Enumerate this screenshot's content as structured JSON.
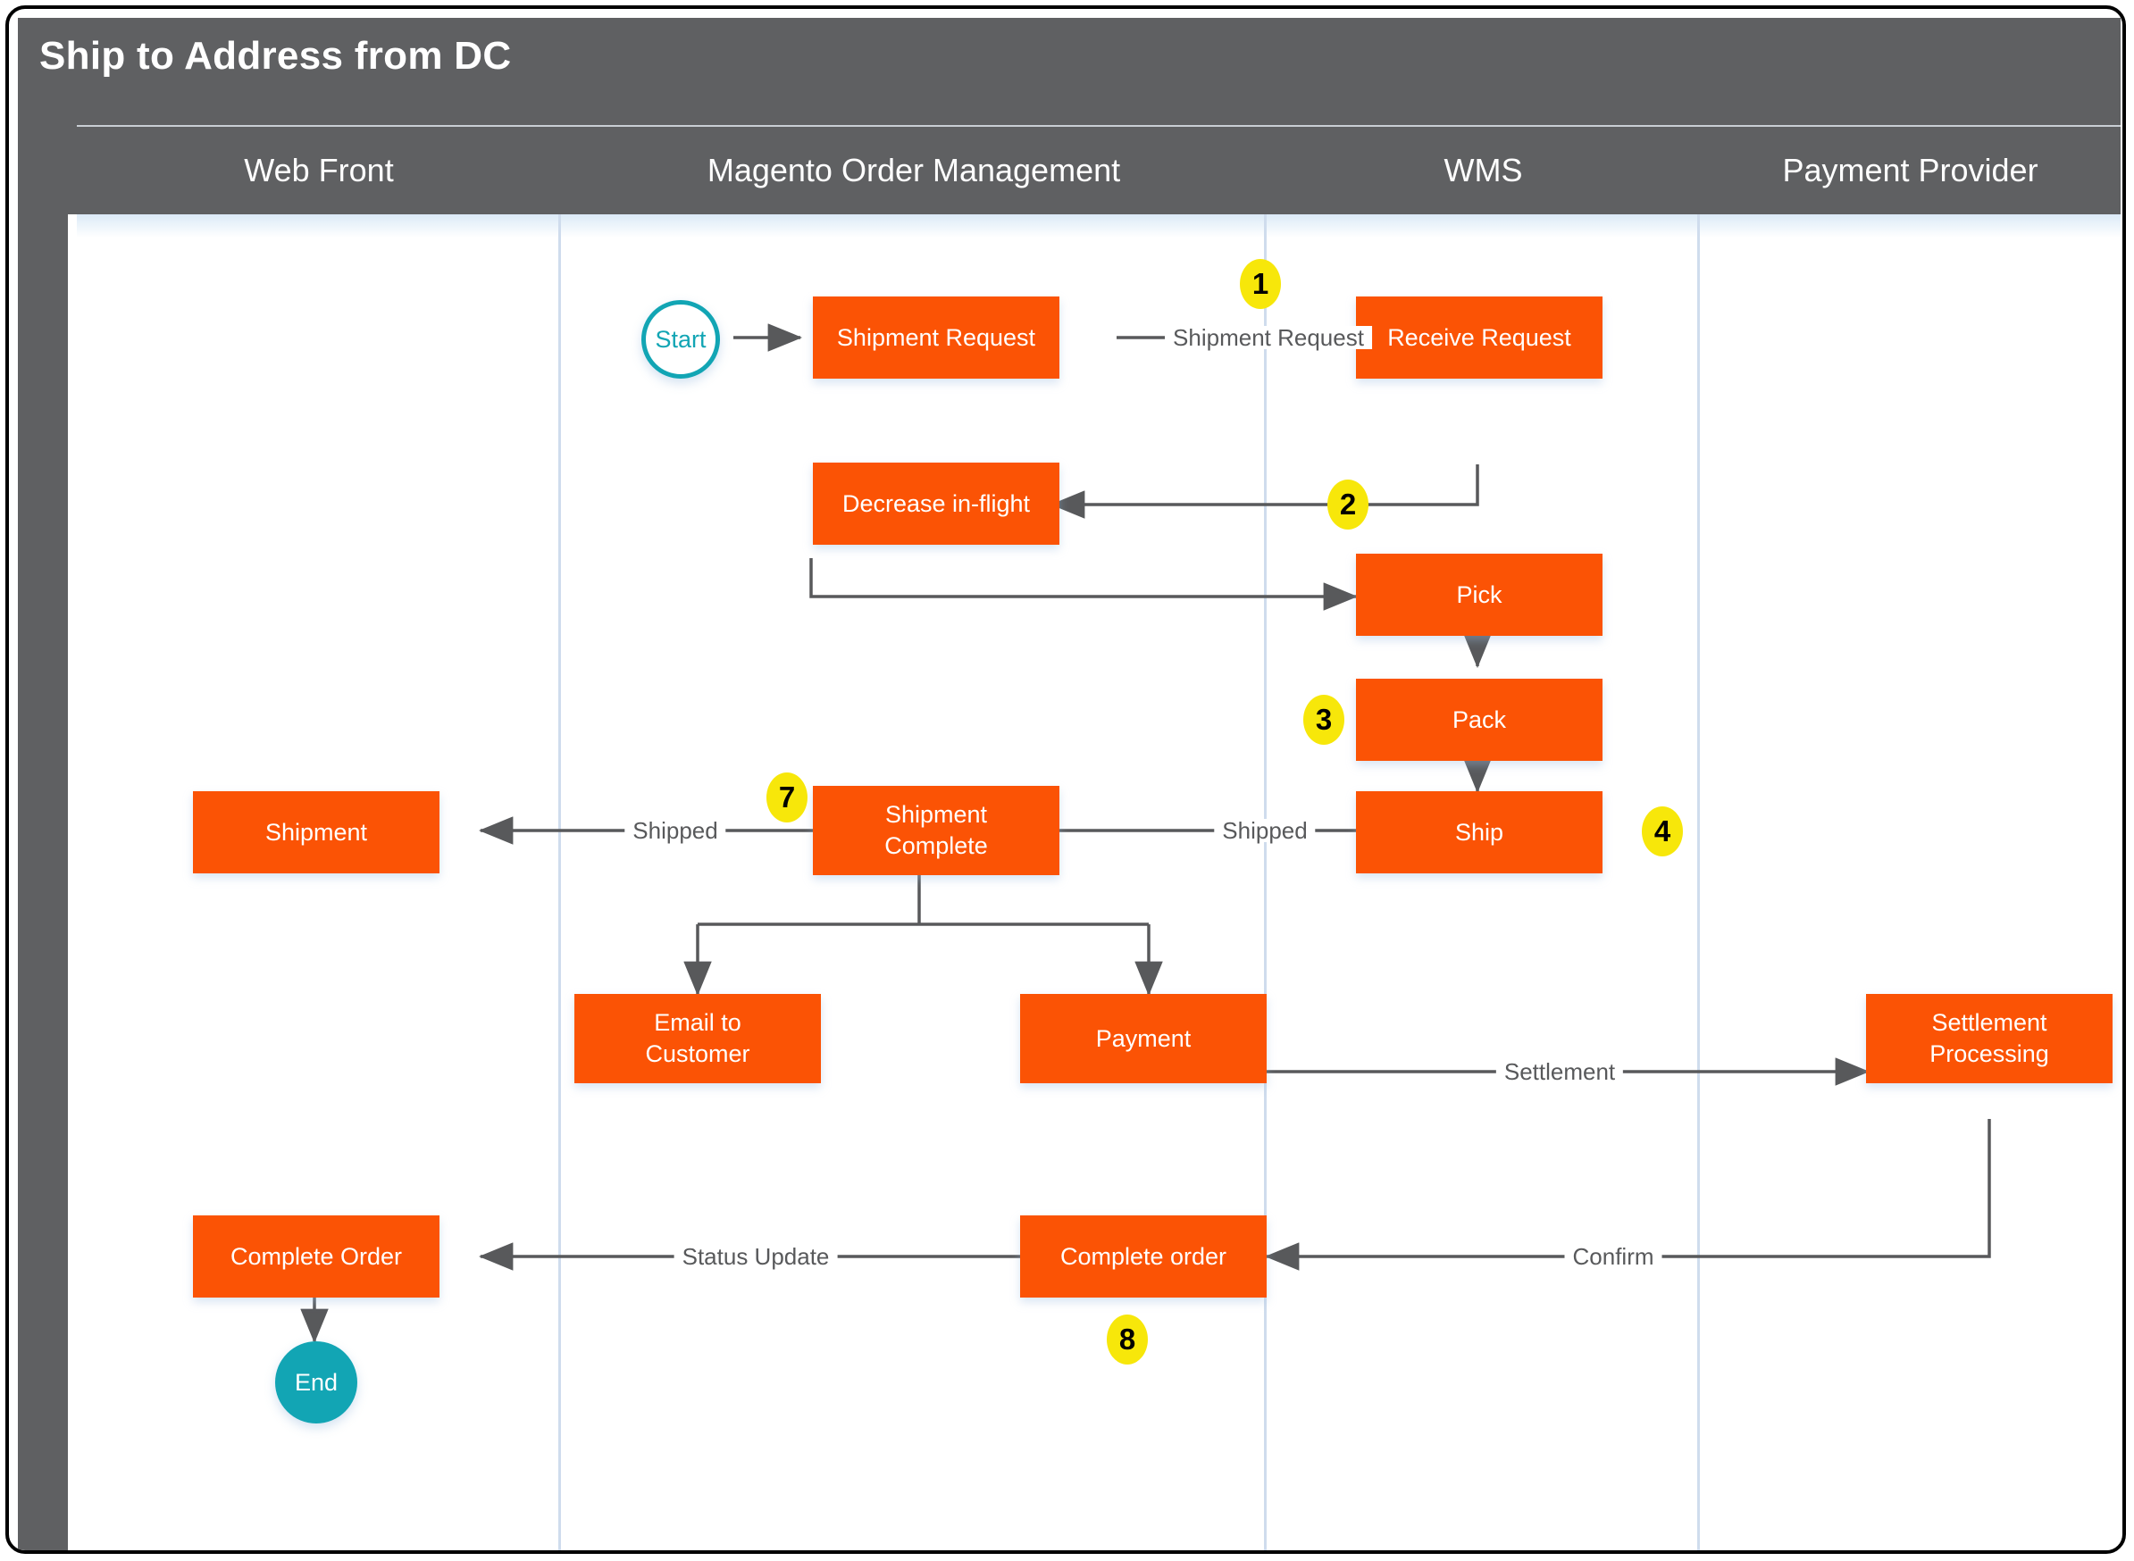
{
  "diagram": {
    "title": "Ship to Address from DC",
    "type": "swimlane-flowchart",
    "colors": {
      "header_bg": "#5f6062",
      "node_fill": "#fb5305",
      "node_text": "#ffffff",
      "terminator_accent": "#12a5b4",
      "badge_fill": "#f7e70a",
      "connector": "#58595b",
      "lane_divider": "#cfdced"
    }
  },
  "lanes": [
    {
      "label": "Web Front"
    },
    {
      "label": "Magento Order Management"
    },
    {
      "label": "WMS"
    },
    {
      "label": "Payment Provider"
    }
  ],
  "nodes": [
    {
      "id": "start",
      "label": "Start",
      "shape": "terminator",
      "lane": "Magento Order Management"
    },
    {
      "id": "shipment_request",
      "label": "Shipment Request",
      "shape": "process",
      "lane": "Magento Order Management"
    },
    {
      "id": "receive_request",
      "label": "Receive Request",
      "shape": "process",
      "lane": "WMS"
    },
    {
      "id": "decrease_in_flight",
      "label": "Decrease in-flight",
      "shape": "process",
      "lane": "Magento Order Management"
    },
    {
      "id": "pick",
      "label": "Pick",
      "shape": "process",
      "lane": "WMS"
    },
    {
      "id": "pack",
      "label": "Pack",
      "shape": "process",
      "lane": "WMS"
    },
    {
      "id": "ship",
      "label": "Ship",
      "shape": "process",
      "lane": "WMS"
    },
    {
      "id": "shipment",
      "label": "Shipment",
      "shape": "process",
      "lane": "Web Front"
    },
    {
      "id": "shipment_complete",
      "label": "Shipment\nComplete",
      "line1": "Shipment",
      "line2": "Complete",
      "shape": "process",
      "lane": "Magento Order Management"
    },
    {
      "id": "email_to_customer",
      "label": "Email to\nCustomer",
      "line1": "Email to",
      "line2": "Customer",
      "shape": "process",
      "lane": "Magento Order Management"
    },
    {
      "id": "payment",
      "label": "Payment",
      "shape": "process",
      "lane": "Magento Order Management"
    },
    {
      "id": "settlement_processing",
      "label": "Settlement\nProcessing",
      "line1": "Settlement",
      "line2": "Processing",
      "shape": "process",
      "lane": "Payment Provider"
    },
    {
      "id": "complete_order_web",
      "label": "Complete Order",
      "shape": "process",
      "lane": "Web Front"
    },
    {
      "id": "complete_order_mom",
      "label": "Complete order",
      "shape": "process",
      "lane": "Magento Order Management"
    },
    {
      "id": "end",
      "label": "End",
      "shape": "terminator",
      "lane": "Web Front"
    }
  ],
  "edges": [
    {
      "from": "start",
      "to": "shipment_request",
      "label": ""
    },
    {
      "from": "shipment_request",
      "to": "receive_request",
      "label": "Shipment Request"
    },
    {
      "from": "receive_request",
      "to": "decrease_in_flight",
      "label": ""
    },
    {
      "from": "decrease_in_flight",
      "to": "pick",
      "label": ""
    },
    {
      "from": "pick",
      "to": "pack",
      "label": ""
    },
    {
      "from": "pack",
      "to": "ship",
      "label": ""
    },
    {
      "from": "ship",
      "to": "shipment_complete",
      "label": "Shipped"
    },
    {
      "from": "shipment_complete",
      "to": "shipment",
      "label": "Shipped"
    },
    {
      "from": "shipment_complete",
      "to": "email_to_customer",
      "label": ""
    },
    {
      "from": "shipment_complete",
      "to": "payment",
      "label": ""
    },
    {
      "from": "payment",
      "to": "settlement_processing",
      "label": "Settlement"
    },
    {
      "from": "settlement_processing",
      "to": "complete_order_mom",
      "label": "Confirm"
    },
    {
      "from": "complete_order_mom",
      "to": "complete_order_web",
      "label": "Status Update"
    },
    {
      "from": "complete_order_web",
      "to": "end",
      "label": ""
    }
  ],
  "edge_labels": {
    "shipment_request": "Shipment Request",
    "shipped_left": "Shipped",
    "shipped_right": "Shipped",
    "settlement": "Settlement",
    "confirm": "Confirm",
    "status_update": "Status Update"
  },
  "badges": [
    {
      "number": "1",
      "near": "shipment-request-to-receive-request"
    },
    {
      "number": "2",
      "near": "receive-request-to-decrease-in-flight"
    },
    {
      "number": "3",
      "near": "pack"
    },
    {
      "number": "4",
      "near": "ship"
    },
    {
      "number": "7",
      "near": "shipment-complete"
    },
    {
      "number": "8",
      "near": "complete-order-mom"
    }
  ]
}
